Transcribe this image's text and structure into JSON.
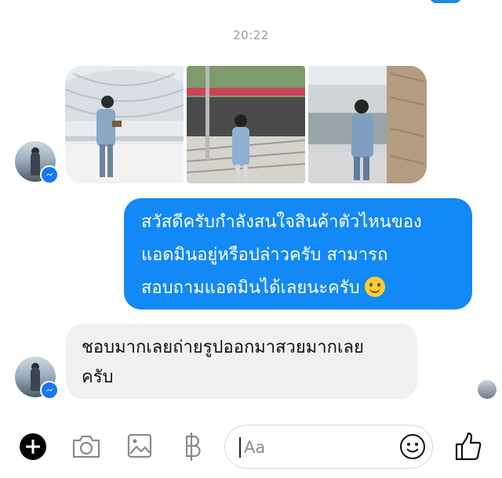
{
  "timestamp": "20:22",
  "messages": {
    "outgoing_lines": [
      "สวัสดีครับกำลังสนใจสินค้าตัวไหนของ",
      "แอดมินอยู่หรือปล่าวครับ สามารถ",
      "สอบถามแอดมินได้เลยนะครับ"
    ],
    "incoming_lines": [
      "ชอบมากเลยถ่ายรูปออกมาสวยมากเลย",
      "ครับ"
    ]
  },
  "composer": {
    "placeholder": "Aa",
    "icons": [
      "plus-icon",
      "camera-icon",
      "gallery-icon",
      "baht-icon",
      "emoji-icon",
      "like-icon"
    ]
  },
  "colors": {
    "accent": "#1289f7",
    "incoming_bubble": "#f0f0f0",
    "messenger_badge": "#1877f2"
  }
}
